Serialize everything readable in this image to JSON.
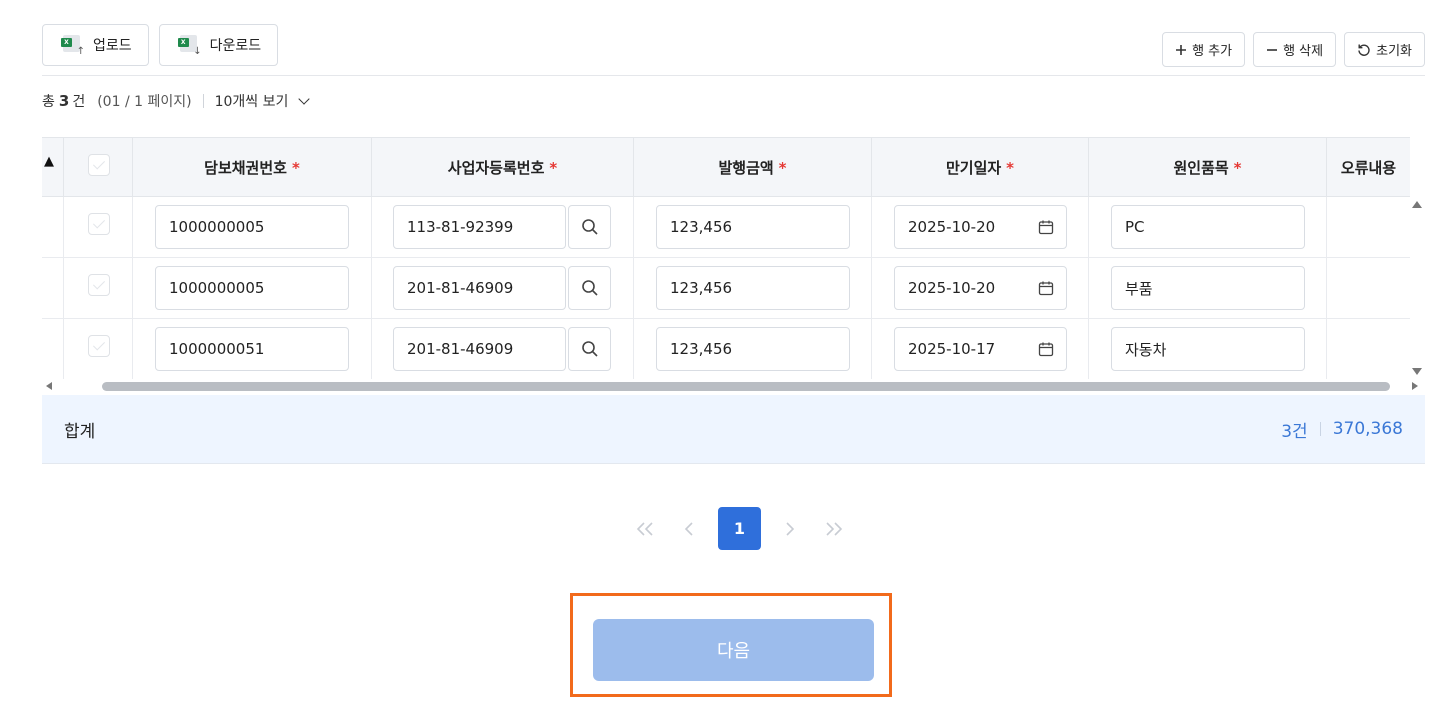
{
  "toolbar": {
    "upload_label": "업로드",
    "download_label": "다운로드",
    "add_row_label": "행 추가",
    "delete_row_label": "행 삭제",
    "reset_label": "초기화"
  },
  "summary": {
    "total_prefix": "총",
    "total_count": "3",
    "total_unit": "건",
    "page_info": "(01 / 1 페이지)",
    "per_page": "10개씩 보기"
  },
  "grid": {
    "columns": [
      "담보채권번호",
      "사업자등록번호",
      "발행금액",
      "만기일자",
      "원인품목",
      "오류내용"
    ],
    "required_mark": "*",
    "rows": [
      {
        "bond_no": "1000000005",
        "biz_no": "113-81-92399",
        "amount": "123,456",
        "due_date": "2025-10-20",
        "item": "PC",
        "error": ""
      },
      {
        "bond_no": "1000000005",
        "biz_no": "201-81-46909",
        "amount": "123,456",
        "due_date": "2025-10-20",
        "item": "부품",
        "error": ""
      },
      {
        "bond_no": "1000000051",
        "biz_no": "201-81-46909",
        "amount": "123,456",
        "due_date": "2025-10-17",
        "item": "자동차",
        "error": ""
      }
    ]
  },
  "totals": {
    "label": "합계",
    "count": "3건",
    "amount": "370,368"
  },
  "pagination": {
    "current_page": "1"
  },
  "next_button_label": "다음",
  "colors": {
    "accent": "#2f6fdb",
    "disabled_button": "#9cbcec",
    "highlight_border": "#f26a1b",
    "required": "#e53935",
    "total_text": "#3b78d6"
  }
}
